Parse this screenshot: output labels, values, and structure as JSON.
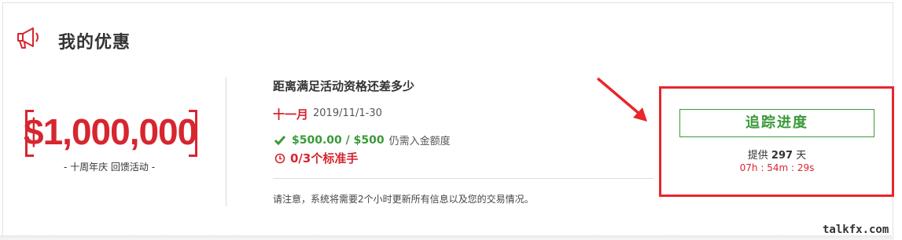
{
  "header": {
    "title": "我的优惠",
    "icon": "megaphone-icon"
  },
  "promo": {
    "amount": "$1,000,000",
    "subtitle": "- 十周年庆 回馈活动 -"
  },
  "eligibility": {
    "title": "距离满足活动资格还差多少",
    "month": "十一月",
    "date_range": "2019/11/1-30",
    "progress_amount": "$500.00 / $500",
    "progress_text": "仍需入金额度",
    "trades_text": "0/3个标准手",
    "notice": "请注意，系统将需要2个小时更新所有信息以及您的交易情况。"
  },
  "tracker": {
    "button_label": "追踪进度",
    "offer_prefix": "提供",
    "offer_days": "297",
    "offer_suffix": "天",
    "countdown": "07h : 54m : 29s"
  },
  "watermark": "talkfx.com",
  "colors": {
    "accent_red": "#d6262f",
    "accent_green": "#3a9a3a",
    "highlight_red": "#e8262c"
  }
}
